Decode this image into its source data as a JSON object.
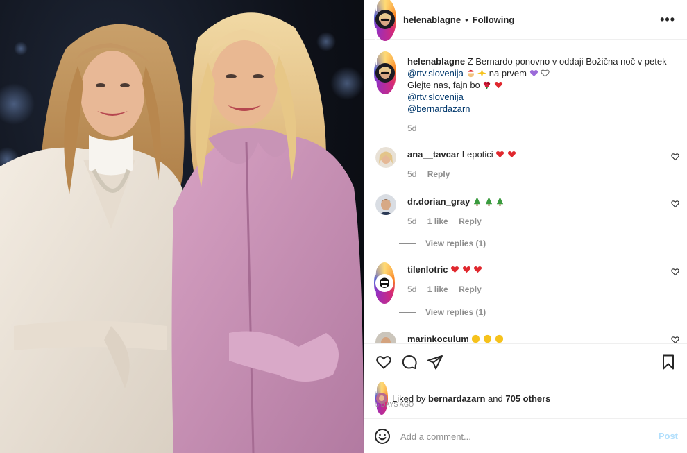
{
  "post": {
    "username": "helenablagne",
    "follow_status": "Following",
    "separator": "•",
    "more_label": "•••",
    "photo_alt": "Two women posing: one in a cream coat, one in a pink coat"
  },
  "caption": {
    "username": "helenablagne",
    "line1": "Z Bernardo ponovno v oddaji Božična noč v petek",
    "mention1": "@rtv.slovenija",
    "line1_end": "na prvem",
    "line2": "Glejte nas, fajn bo",
    "mention2": "@rtv.slovenija",
    "mention3": "@bernardazarn",
    "time": "5d"
  },
  "comments": [
    {
      "username": "ana__tavcar",
      "text": "Lepotici",
      "time": "5d",
      "likes": "",
      "reply": "Reply"
    },
    {
      "username": "dr.dorian_gray",
      "text": "",
      "time": "5d",
      "likes": "1 like",
      "reply": "Reply",
      "view_replies": "View replies (1)"
    },
    {
      "username": "tilenlotric",
      "text": "",
      "time": "5d",
      "likes": "1 like",
      "reply": "Reply",
      "view_replies": "View replies (1)"
    },
    {
      "username": "marinkoculum",
      "text": ""
    }
  ],
  "likes": {
    "prefix": "Liked by",
    "user": "bernardazarn",
    "mid": "and",
    "count": "705 others"
  },
  "date": "5 DAYS AGO",
  "add_comment": {
    "placeholder": "Add a comment...",
    "post_label": "Post"
  },
  "colors": {
    "link": "#00376b",
    "muted": "#8e8e8e",
    "post_disabled": "#b2dffc",
    "heart": "#ed4956"
  }
}
